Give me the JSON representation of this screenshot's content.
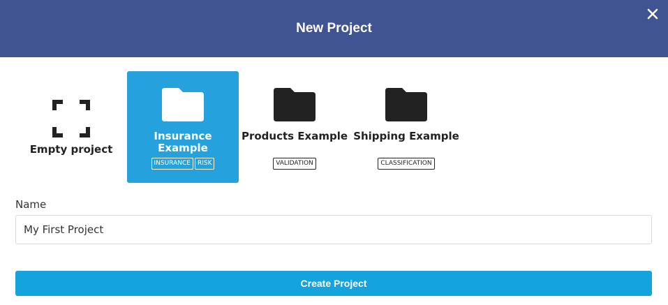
{
  "dialog": {
    "title": "New Project",
    "close_icon": "close-icon"
  },
  "templates": [
    {
      "label": "Empty project",
      "icon": "empty-project-icon",
      "tags": [],
      "selected": false
    },
    {
      "label": "Insurance Example",
      "icon": "folder-icon",
      "tags": [
        "INSURANCE",
        "RISK"
      ],
      "selected": true
    },
    {
      "label": "Products Example",
      "icon": "folder-icon",
      "tags": [
        "VALIDATION"
      ],
      "selected": false
    },
    {
      "label": "Shipping Example",
      "icon": "folder-icon",
      "tags": [
        "CLASSIFICATION"
      ],
      "selected": false
    }
  ],
  "form": {
    "name_label": "Name",
    "name_value": "My First Project"
  },
  "actions": {
    "create_label": "Create Project"
  },
  "colors": {
    "header": "#405494",
    "selected_tile": "#25a2de",
    "primary_button": "#14a3dd"
  }
}
